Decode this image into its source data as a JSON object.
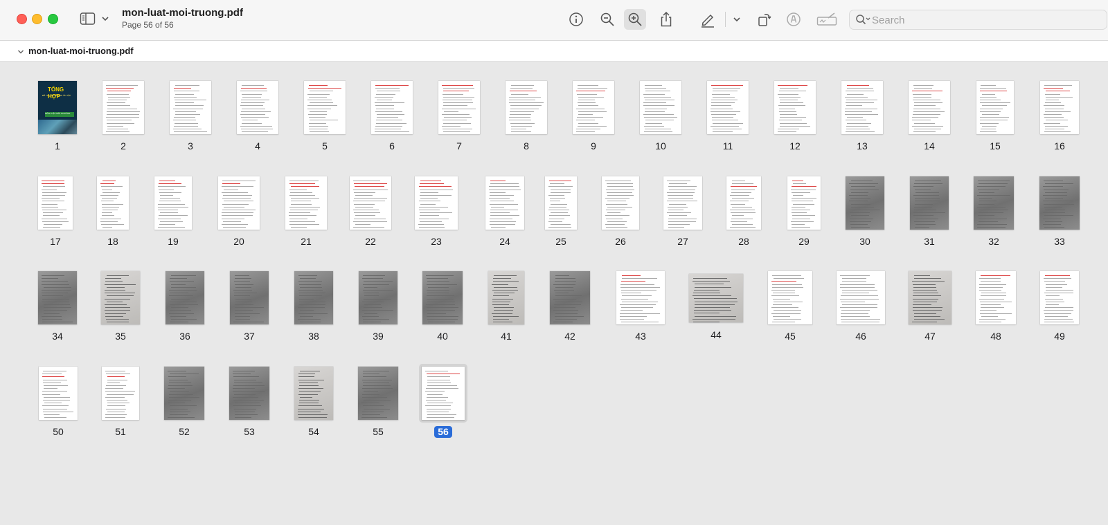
{
  "window": {
    "title": "mon-luat-moi-truong.pdf",
    "subtitle": "Page 56 of 56"
  },
  "toolbar": {
    "sidebar_icon": "sidebar-icon",
    "info_icon": "info-icon",
    "zoom_out_icon": "zoom-out-icon",
    "zoom_in_icon": "zoom-in-icon",
    "share_icon": "share-icon",
    "markup_icon": "pen-icon",
    "rotate_icon": "rotate-icon",
    "annotate_icon": "annotate-icon",
    "sign_icon": "signature-icon"
  },
  "search": {
    "placeholder": "Search",
    "value": ""
  },
  "document_bar": {
    "filename": "mon-luat-moi-truong.pdf"
  },
  "pages": {
    "selected": "56",
    "labels": [
      "1",
      "2",
      "3",
      "4",
      "5",
      "6",
      "7",
      "8",
      "9",
      "10",
      "11",
      "12",
      "13",
      "14",
      "15",
      "16",
      "17",
      "18",
      "19",
      "20",
      "21",
      "22",
      "23",
      "24",
      "25",
      "26",
      "27",
      "28",
      "29",
      "30",
      "31",
      "32",
      "33",
      "34",
      "35",
      "36",
      "37",
      "38",
      "39",
      "40",
      "41",
      "42",
      "43",
      "44",
      "45",
      "46",
      "47",
      "48",
      "49",
      "50",
      "51",
      "52",
      "53",
      "54",
      "55",
      "56"
    ],
    "cover": {
      "line1": "TỔNG HỢP",
      "line2": "ĐỀ THI - ĐỀ CƯƠNG ÔN TẬP",
      "line3": "MÔN LUẬT MÔI TRƯỜNG"
    }
  },
  "colors": {
    "selection": "#2a6cd8",
    "close": "#ff5f57",
    "minimize": "#febc2e",
    "maximize": "#28c840"
  }
}
